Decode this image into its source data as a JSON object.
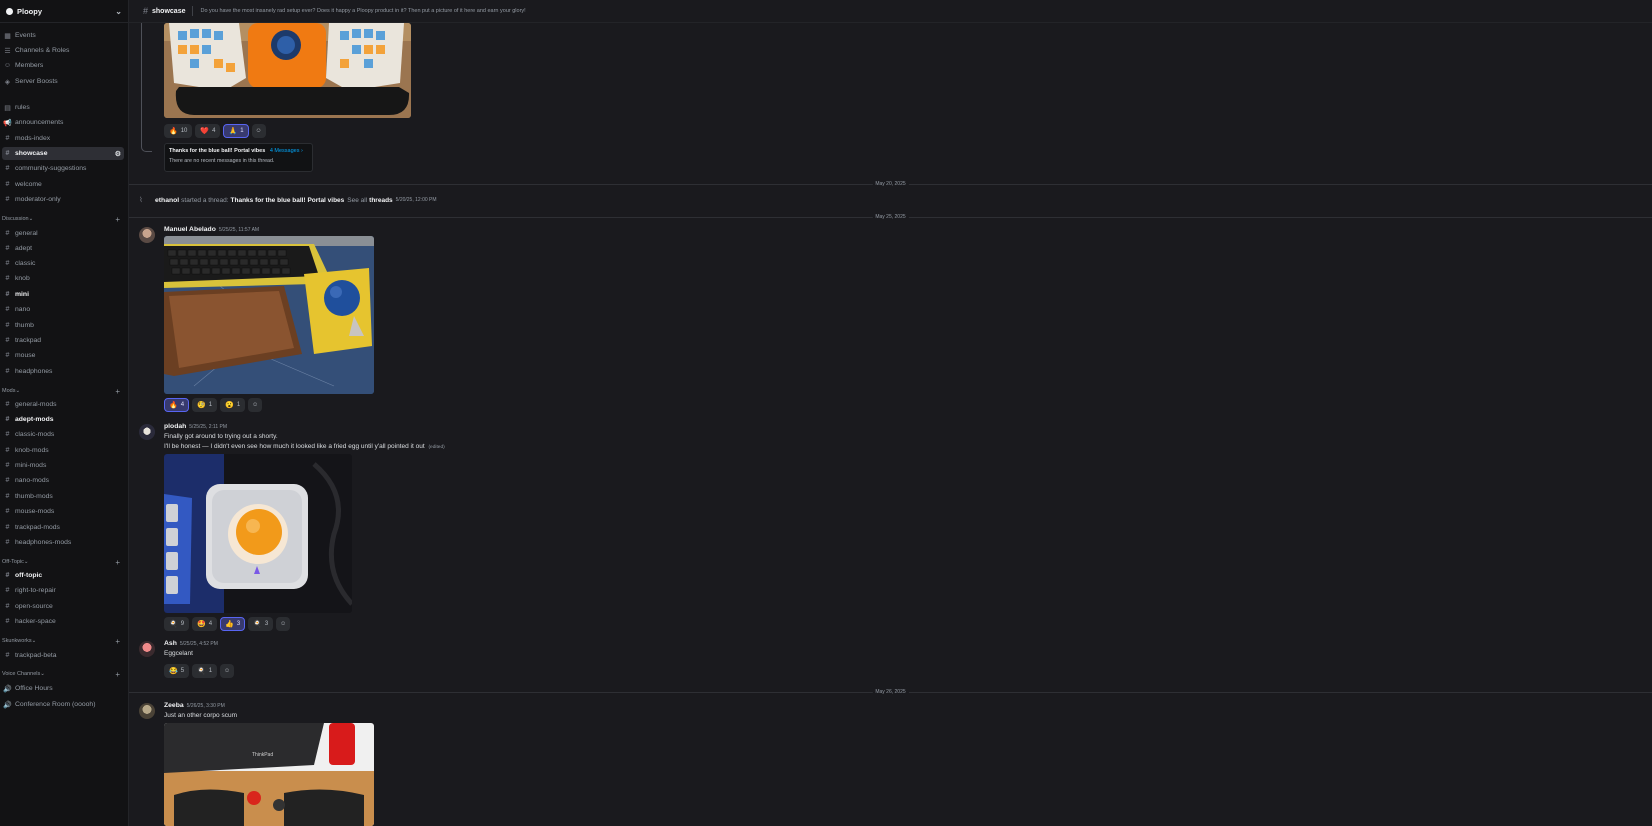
{
  "server": {
    "name": "Ploopy"
  },
  "sidebar_top": [
    {
      "label": "Events",
      "icon": "calendar-icon"
    },
    {
      "label": "Channels & Roles",
      "icon": "list-icon"
    },
    {
      "label": "Members",
      "icon": "members-icon"
    },
    {
      "label": "Server Boosts",
      "icon": "boost-icon"
    }
  ],
  "channels_top": [
    {
      "label": "rules",
      "icon": "rules-icon"
    },
    {
      "label": "announcements",
      "icon": "megaphone-icon"
    },
    {
      "label": "mods-index",
      "icon": "hash-icon"
    },
    {
      "label": "showcase",
      "icon": "hash-icon"
    },
    {
      "label": "community-suggestions",
      "icon": "hash-icon"
    },
    {
      "label": "welcome",
      "icon": "hash-icon"
    },
    {
      "label": "moderator-only",
      "icon": "hash-icon"
    }
  ],
  "categories": {
    "discussion": "Discussion",
    "mods": "Mods",
    "offtopic": "Off-Topic",
    "skunkworks": "Skunkworks",
    "voice": "Voice Channels"
  },
  "discussion_channels": [
    "general",
    "adept",
    "classic",
    "knob",
    "mini",
    "nano",
    "thumb",
    "trackpad",
    "mouse",
    "headphones"
  ],
  "mods_channels": [
    "general-mods",
    "adept-mods",
    "classic-mods",
    "knob-mods",
    "mini-mods",
    "nano-mods",
    "thumb-mods",
    "mouse-mods",
    "trackpad-mods",
    "headphones-mods"
  ],
  "offtopic_channels": [
    "off-topic",
    "right-to-repair",
    "open-source",
    "hacker-space"
  ],
  "skunkworks_channels": [
    "trackpad-beta"
  ],
  "voice_channels": [
    "Office Hours",
    "Conference Room (ooooh)"
  ],
  "topbar": {
    "channel": "showcase",
    "topic": "Do you have the most insanely rad setup ever? Does it happy a Ploopy product in it? Then put a picture of it here and earn your glory!"
  },
  "messages": {
    "first_reactions": [
      {
        "emoji": "🔥",
        "count": "10",
        "mine": false
      },
      {
        "emoji": "❤️",
        "count": "4",
        "mine": false
      },
      {
        "emoji": "🙏",
        "count": "1",
        "mine": true
      }
    ],
    "thread_card": {
      "title": "Thanks for the blue ball! Portal vibes",
      "link": "4 Messages ›",
      "note": "There are no recent messages in this thread."
    },
    "divider1": "May 20, 2025",
    "system": {
      "author": "ethanol",
      "action": "started a thread:",
      "thread": "Thanks for the blue ball! Portal vibes",
      "see_all": "See all",
      "threads": "threads",
      "time": "5/20/25, 12:00 PM"
    },
    "divider2": "May 25, 2025",
    "m1": {
      "author": "Manuel Abelado",
      "time": "5/25/25, 11:57 AM",
      "reactions": [
        {
          "emoji": "🔥",
          "count": "4",
          "mine": true
        },
        {
          "emoji": "🧐",
          "count": "1",
          "mine": false
        },
        {
          "emoji": "😮",
          "count": "1",
          "mine": false
        }
      ]
    },
    "m2": {
      "author": "plodah",
      "time": "5/25/25, 2:11 PM",
      "line1": "Finally got around to trying out a shorty.",
      "line2": "I'll be honest — I didn't even see how much it looked like a fried egg until y'all pointed it out",
      "edited": "(edited)",
      "reactions": [
        {
          "emoji": "🍳",
          "count": "9",
          "mine": false
        },
        {
          "emoji": "🤩",
          "count": "4",
          "mine": false
        },
        {
          "emoji": "👍",
          "count": "3",
          "mine": true
        },
        {
          "emoji": "🍳",
          "count": "3",
          "mine": false
        }
      ]
    },
    "m3": {
      "author": "Ash",
      "time": "5/25/25, 4:52 PM",
      "text": "Eggcelant",
      "reactions": [
        {
          "emoji": "😂",
          "count": "5",
          "mine": false
        },
        {
          "emoji": "🍳",
          "count": "1",
          "mine": false
        }
      ]
    },
    "divider3": "May 26, 2025",
    "m4": {
      "author": "Zeeba",
      "time": "5/26/25, 3:30 PM",
      "text": "Just an other corpo scum",
      "img_brand": "ThinkPad"
    }
  }
}
